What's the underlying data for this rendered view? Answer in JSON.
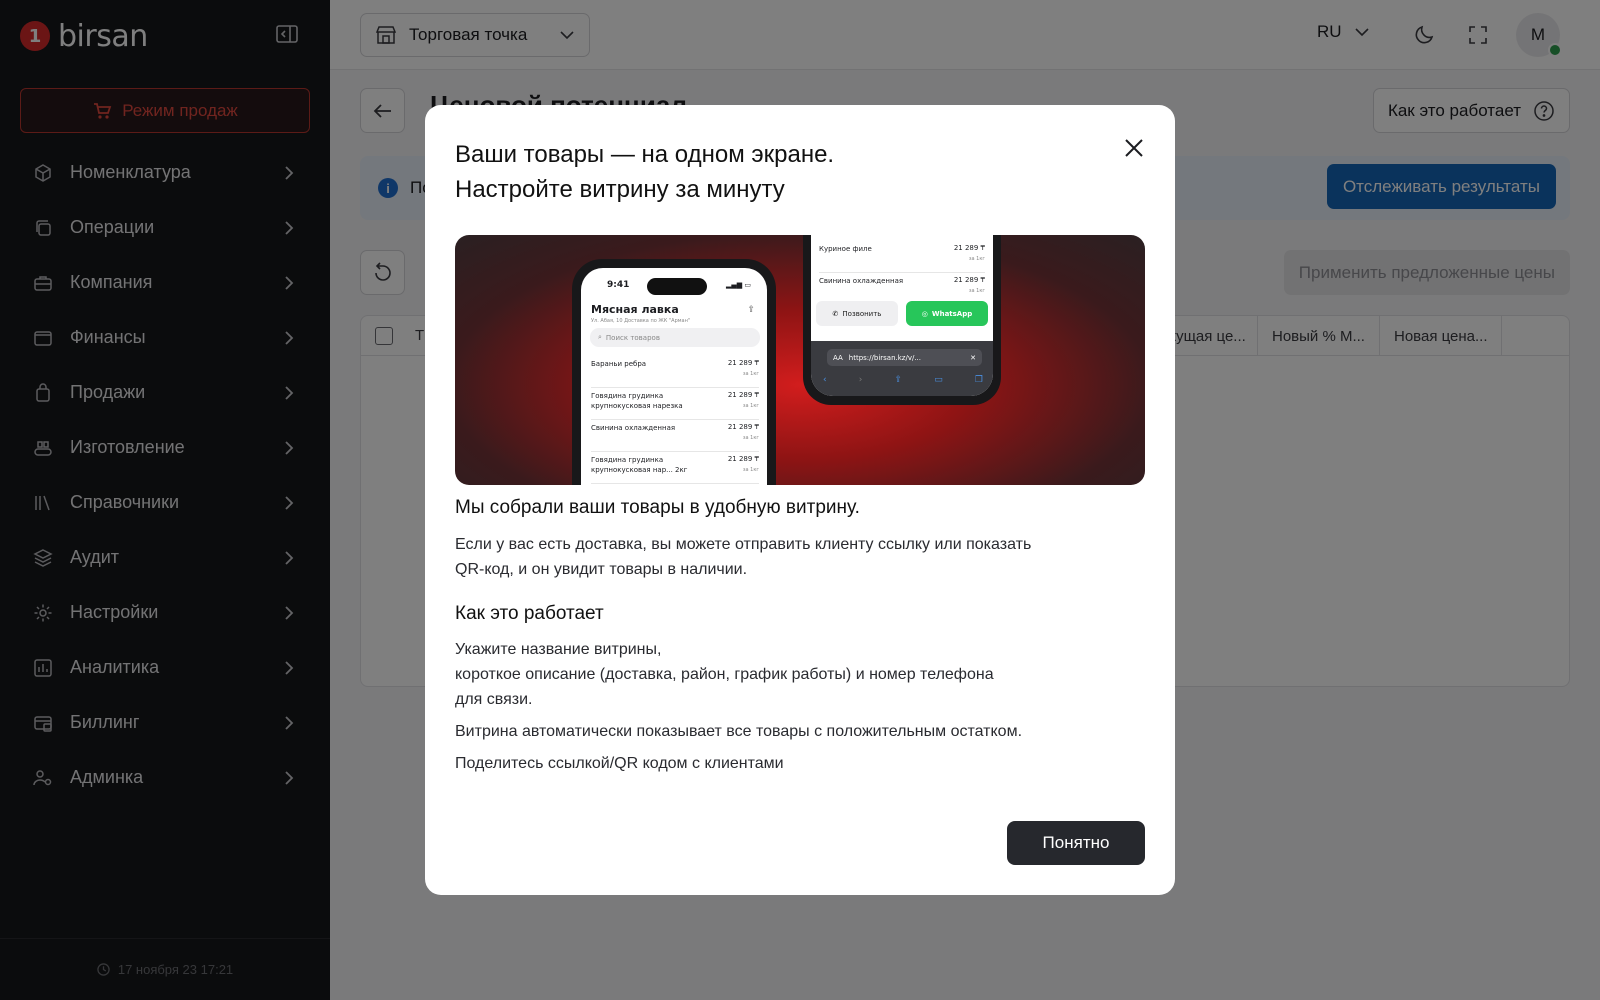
{
  "app": {
    "logo_text": "birsan",
    "logo_mark": "1"
  },
  "sidebar": {
    "sales_mode_label": "Режим продаж",
    "items": [
      {
        "label": "Номенклатура",
        "icon": "box-icon"
      },
      {
        "label": "Операции",
        "icon": "operations-icon"
      },
      {
        "label": "Компания",
        "icon": "briefcase-icon"
      },
      {
        "label": "Финансы",
        "icon": "wallet-icon"
      },
      {
        "label": "Продажи",
        "icon": "bag-icon"
      },
      {
        "label": "Изготовление",
        "icon": "conveyor-icon"
      },
      {
        "label": "Справочники",
        "icon": "books-icon"
      },
      {
        "label": "Аудит",
        "icon": "layers-icon"
      },
      {
        "label": "Настройки",
        "icon": "gear-icon"
      },
      {
        "label": "Аналитика",
        "icon": "analytics-icon"
      },
      {
        "label": "Биллинг",
        "icon": "billing-icon"
      },
      {
        "label": "Админка",
        "icon": "users-gear-icon"
      }
    ],
    "footer_timestamp": "17 ноября 23 17:21"
  },
  "topbar": {
    "store_label": "Торговая точка",
    "language": "RU",
    "avatar_initial": "М"
  },
  "page": {
    "title": "Ценовой потенциал",
    "how_it_works_label": "Как это работает",
    "info_text": "По",
    "track_results_label": "Отслеживать результаты",
    "apply_prices_label": "Применить предложенные цены",
    "table_headers": [
      "Т",
      "екущая це...",
      "Новый % М...",
      "Новая цена..."
    ]
  },
  "modal": {
    "title_line1": "Ваши товары — на одном экране.",
    "title_line2": "Настройте витрину за минуту",
    "section1_heading": "Мы собрали ваши товары в удобную витрину.",
    "section1_text_line1": "Если у вас есть доставка, вы можете отправить клиенту ссылку или показать",
    "section1_text_line2": "QR-код, и он увидит товары в наличии.",
    "section2_heading": "Как это работает",
    "step1_line1": "Укажите название витрины,",
    "step1_line2": "короткое описание (доставка, район, график работы) и номер телефона",
    "step1_line3": "для связи.",
    "step2": "Витрина автоматически показывает все товары с положительным остатком.",
    "step3": "Поделитесь ссылкой/QR кодом с клиентами",
    "confirm_label": "Понятно",
    "preview": {
      "time": "9:41",
      "shop_name": "Мясная лавка",
      "shop_address": "Ул. Абая, 10 Доставка по ЖК \"Арман\"",
      "search_placeholder": "Поиск товаров",
      "products": [
        {
          "name": "Бараньи ребра",
          "price": "21 289 ₸",
          "unit": "за 1кг"
        },
        {
          "name": "Говядина грудинка крупнокусковая нарезка",
          "price": "21 289 ₸",
          "unit": "за 1кг"
        },
        {
          "name": "Свинина охлажденная",
          "price": "21 289 ₸",
          "unit": "за 1кг"
        },
        {
          "name": "Говядина грудинка крупнокусковая нар... 2кг",
          "price": "21 289 ₸",
          "unit": "за 1кг"
        }
      ],
      "products2": [
        {
          "name": "Куриное филе",
          "price": "21 289 ₸",
          "unit": "за 1кг"
        },
        {
          "name": "Свинина охлажденная",
          "price": "21 289 ₸",
          "unit": "за 1кг"
        }
      ],
      "call_label": "Позвонить",
      "whatsapp_label": "WhatsApp",
      "url_text": "https://birsan.kz/v/...",
      "url_prefix": "AA"
    }
  },
  "colors": {
    "brand_red": "#d62a2a",
    "sidebar_bg": "#17181b",
    "primary_blue": "#1466b8",
    "whatsapp_green": "#27c65a",
    "status_online": "#2e9e4f"
  }
}
